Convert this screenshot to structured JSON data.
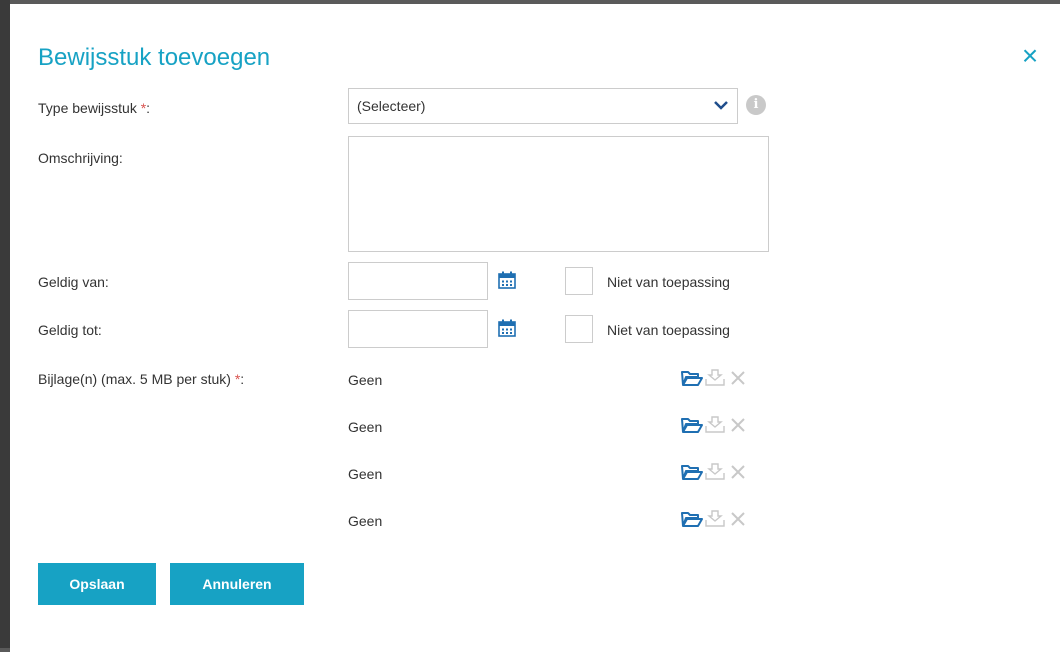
{
  "dialog": {
    "title": "Bewijsstuk toevoegen",
    "close_icon": "close-icon"
  },
  "form": {
    "type": {
      "label": "Type bewijsstuk ",
      "required_mark": "*",
      "colon": ":",
      "selected": "(Selecteer)",
      "info_icon": "info-icon"
    },
    "description": {
      "label": "Omschrijving:",
      "value": ""
    },
    "valid_from": {
      "label": "Geldig van:",
      "value": "",
      "not_applicable": "Niet van toepassing",
      "checked": false
    },
    "valid_to": {
      "label": "Geldig tot:",
      "value": "",
      "not_applicable": "Niet van toepassing",
      "checked": false
    },
    "attachments": {
      "label": "Bijlage(n) (max. 5 MB per stuk) ",
      "required_mark": "*",
      "colon": ":",
      "items": [
        "Geen",
        "Geen",
        "Geen",
        "Geen"
      ],
      "icons": [
        "folder-open-icon",
        "download-icon",
        "delete-icon"
      ]
    }
  },
  "buttons": {
    "save": "Opslaan",
    "cancel": "Annuleren"
  },
  "colors": {
    "accent": "#17a2c4",
    "required": "#d9534f",
    "icon_active": "#1f6fb2",
    "icon_disabled": "#c8c8c8"
  }
}
